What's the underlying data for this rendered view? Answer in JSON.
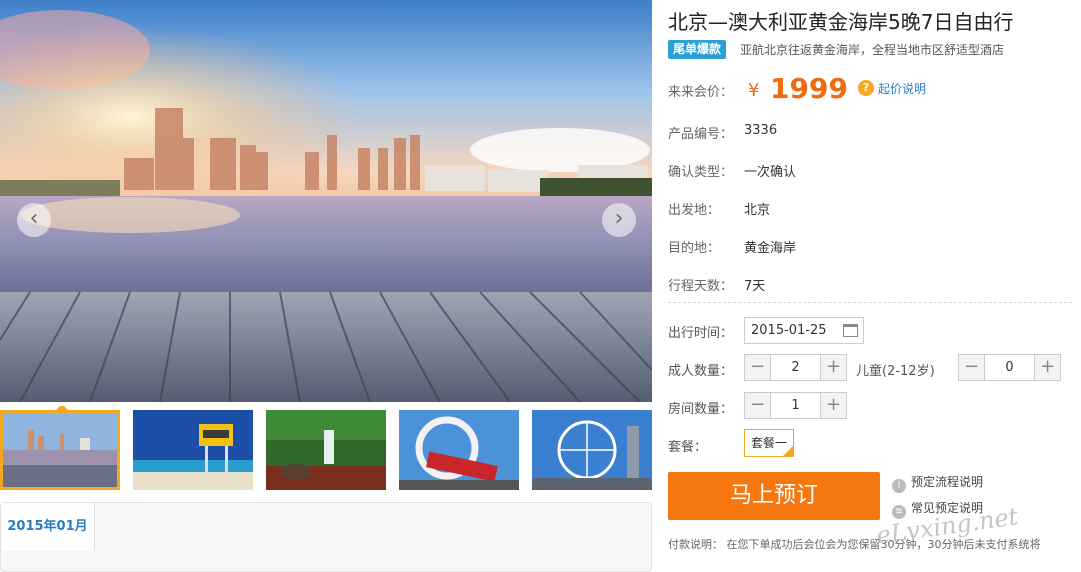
{
  "product": {
    "title": "北京—澳大利亚黄金海岸5晚7日自由行",
    "tag": "尾单爆款",
    "subtitle": "亚航北京往返黄金海岸，全程当地市区舒适型酒店"
  },
  "price": {
    "label": "来来会价：",
    "currency": "¥",
    "value": "1999",
    "help_link": "起价说明"
  },
  "info": [
    {
      "label": "产品编号：",
      "value": "3336"
    },
    {
      "label": "确认类型：",
      "value": "一次确认"
    },
    {
      "label": "出发地：",
      "value": "北京"
    },
    {
      "label": "目的地：",
      "value": "黄金海岸"
    },
    {
      "label": "行程天数：",
      "value": "7天"
    }
  ],
  "booking": {
    "date_label": "出行时间：",
    "date_value": "2015-01-25",
    "adult_label": "成人数量：",
    "adult_value": "2",
    "child_label": "儿童(2-12岁)",
    "child_value": "0",
    "room_label": "房间数量：",
    "room_value": "1",
    "package_label": "套餐：",
    "package_value": "套餐一",
    "minus": "−",
    "plus": "+"
  },
  "actions": {
    "book": "马上预订",
    "process_link": "预定流程说明",
    "faq_link": "常见预定说明"
  },
  "payment_note": "付款说明：  在您下单成功后会位会为您保留30分钟，30分钟后未支付系统将",
  "calendar": {
    "month_tab": "2015年01月"
  },
  "gallery": {
    "prev": "‹",
    "next": "›",
    "thumbnails": [
      "gold-coast-skyline",
      "lifeguard-tower-beach",
      "rainforest-waterfall",
      "rollercoaster",
      "ferris-wheel"
    ]
  },
  "watermark": "eLvxing.net",
  "colors": {
    "accent": "#f6770f",
    "price": "#f06a0f",
    "link": "#2a7ec2",
    "tag": "#2aa0d6",
    "highlight": "#f5a623"
  }
}
